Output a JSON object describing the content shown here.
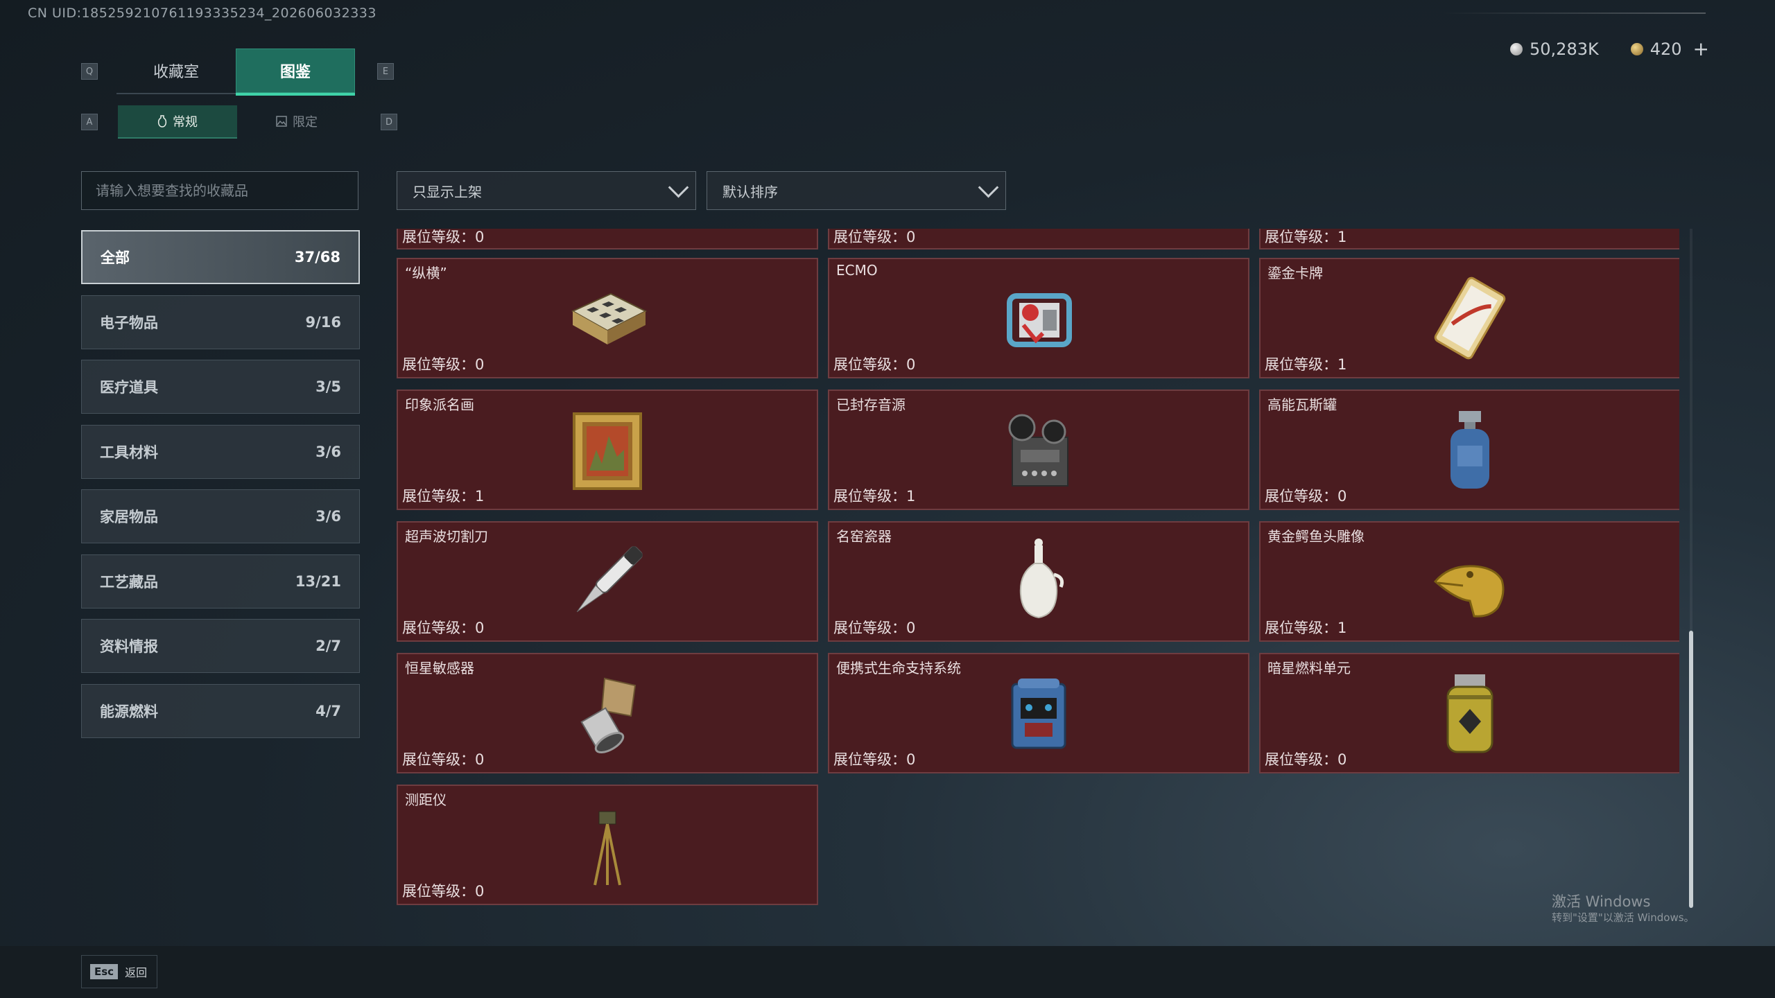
{
  "uid_text": "CN UID:18525921076119333523​4_202606032333",
  "currency": {
    "silver": "50,283K",
    "gold": "420",
    "plus": "+"
  },
  "keys": {
    "prev_tab": "Q",
    "next_tab": "E",
    "prev_sub": "A",
    "next_sub": "D"
  },
  "main_tabs": [
    {
      "label": "收藏室",
      "active": false
    },
    {
      "label": "图鉴",
      "active": true
    }
  ],
  "sub_tabs": [
    {
      "label": "常规",
      "icon": "vase-icon",
      "active": true
    },
    {
      "label": "限定",
      "icon": "image-icon",
      "active": false
    }
  ],
  "search": {
    "placeholder": "请输入想要查找的收藏品"
  },
  "categories": [
    {
      "label": "全部",
      "count": "37/68",
      "active": true
    },
    {
      "label": "电子物品",
      "count": "9/16"
    },
    {
      "label": "医疗道具",
      "count": "3/5"
    },
    {
      "label": "工具材料",
      "count": "3/6"
    },
    {
      "label": "家居物品",
      "count": "3/6"
    },
    {
      "label": "工艺藏品",
      "count": "13/21"
    },
    {
      "label": "资料情报",
      "count": "2/7"
    },
    {
      "label": "能源燃料",
      "count": "4/7"
    }
  ],
  "filters": {
    "display": "只显示上架",
    "sort": "默认排序"
  },
  "level_label": "展位等级：",
  "partial_row": [
    "0",
    "0",
    "1"
  ],
  "items": [
    {
      "name": "“纵横”",
      "level": "0",
      "icon": "chess-box-icon"
    },
    {
      "name": "ECMO",
      "level": "0",
      "icon": "ecmo-machine-icon"
    },
    {
      "name": "鎏金卡牌",
      "level": "1",
      "icon": "gilded-card-icon"
    },
    {
      "name": "印象派名画",
      "level": "1",
      "icon": "framed-painting-icon"
    },
    {
      "name": "已封存音源",
      "level": "1",
      "icon": "reel-recorder-icon"
    },
    {
      "name": "高能瓦斯罐",
      "level": "0",
      "icon": "gas-canister-icon"
    },
    {
      "name": "超声波切割刀",
      "level": "0",
      "icon": "ultrasonic-knife-icon"
    },
    {
      "name": "名窑瓷器",
      "level": "0",
      "icon": "porcelain-vase-icon"
    },
    {
      "name": "黄金鳄鱼头雕像",
      "level": "1",
      "icon": "golden-crocodile-icon"
    },
    {
      "name": "恒星敏感器",
      "level": "0",
      "icon": "star-sensor-icon"
    },
    {
      "name": "便携式生命支持系统",
      "level": "0",
      "icon": "life-support-icon"
    },
    {
      "name": "暗星燃料单元",
      "level": "0",
      "icon": "fuel-cell-icon"
    },
    {
      "name": "测距仪",
      "level": "0",
      "icon": "rangefinder-icon"
    }
  ],
  "esc": {
    "key": "Esc",
    "label": "返回"
  },
  "watermark": {
    "line1": "激活 Windows",
    "line2": "转到\"设置\"以激活 Windows。"
  }
}
